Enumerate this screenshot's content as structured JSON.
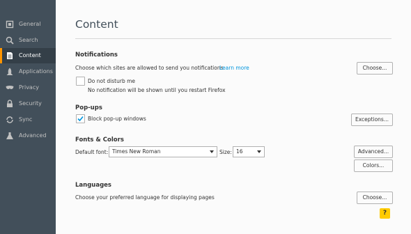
{
  "sidebar": {
    "items": [
      {
        "label": "General",
        "icon": "general-icon"
      },
      {
        "label": "Search",
        "icon": "search-icon"
      },
      {
        "label": "Content",
        "icon": "content-icon",
        "active": true
      },
      {
        "label": "Applications",
        "icon": "applications-icon"
      },
      {
        "label": "Privacy",
        "icon": "privacy-icon"
      },
      {
        "label": "Security",
        "icon": "security-icon"
      },
      {
        "label": "Sync",
        "icon": "sync-icon"
      },
      {
        "label": "Advanced",
        "icon": "advanced-icon"
      }
    ]
  },
  "page": {
    "title": "Content"
  },
  "notifications": {
    "heading": "Notifications",
    "description": "Choose which sites are allowed to send you notifications",
    "learn_more": "Learn more",
    "choose_button": "Choose...",
    "dnd_label": "Do not disturb me",
    "dnd_note": "No notification will be shown until you restart Firefox"
  },
  "popups": {
    "heading": "Pop-ups",
    "block_label": "Block pop-up windows",
    "exceptions_button": "Exceptions..."
  },
  "fonts": {
    "heading": "Fonts & Colors",
    "default_font_label": "Default font:",
    "default_font_value": "Times New Roman",
    "size_label": "Size:",
    "size_value": "16",
    "advanced_button": "Advanced...",
    "colors_button": "Colors..."
  },
  "languages": {
    "heading": "Languages",
    "description": "Choose your preferred language for displaying pages",
    "choose_button": "Choose..."
  },
  "help": {
    "label": "?"
  },
  "colors": {
    "sidebar_bg": "#424f5a",
    "accent": "#ff9500",
    "link": "#0095dd",
    "help_bg": "#ffcb00"
  }
}
